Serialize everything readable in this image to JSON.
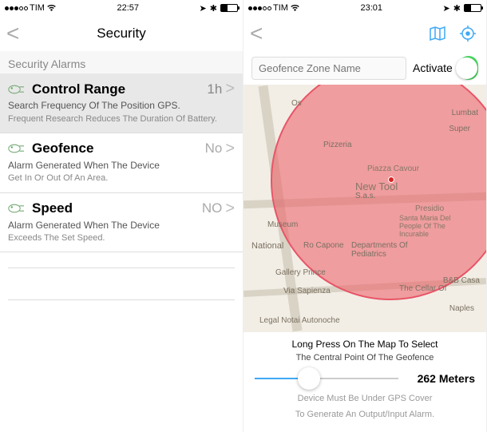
{
  "left": {
    "status": {
      "carrier": "TIM",
      "time": "22:57"
    },
    "nav": {
      "title": "Security"
    },
    "section_header": "Security Alarms",
    "rows": [
      {
        "title": "Control Range",
        "value": "1h",
        "sub1": "Search Frequency Of The Position GPS.",
        "sub2": "Frequent Research Reduces The Duration Of Battery."
      },
      {
        "title": "Geofence",
        "value": "No",
        "sub1": "Alarm Generated When The Device",
        "sub2": "Get In Or Out Of An Area."
      },
      {
        "title": "Speed",
        "value": "NO",
        "sub1": "Alarm Generated When The Device",
        "sub2": "Exceeds The Set Speed."
      }
    ]
  },
  "right": {
    "status": {
      "carrier": "TIM",
      "time": "23:01"
    },
    "toolbar": {
      "placeholder": "Geofence Zone Name",
      "activate": "Activate"
    },
    "map": {
      "labels": {
        "pizzeria": "Pizzeria",
        "piazza": "Piazza Cavour",
        "newtool": "New Tool",
        "sas": "S.a.s.",
        "presidio": "Presidio",
        "santamaria": "Santa Maria Del People Of The Incurable",
        "museum": "Museum",
        "national": "National",
        "capone": "Ro Capone",
        "pediatrics": "Departments Of Pediatrics",
        "gallery": "Gallery Prince",
        "sapienza": "Via Sapienza",
        "cellar": "The Cellar Of",
        "bb": "B&B Casa",
        "naples": "Naples",
        "lumbat": "Lumbat",
        "super": "Super",
        "os": "Os",
        "notai": "Legal Notai Autonoche"
      }
    },
    "hint1": "Long Press On The Map To Select",
    "hint2": "The Central Point Of The Geofence",
    "meters_value": "262 Meters",
    "bottom1": "Device Must Be Under GPS Cover",
    "bottom2": "To Generate An Output/Input Alarm."
  }
}
